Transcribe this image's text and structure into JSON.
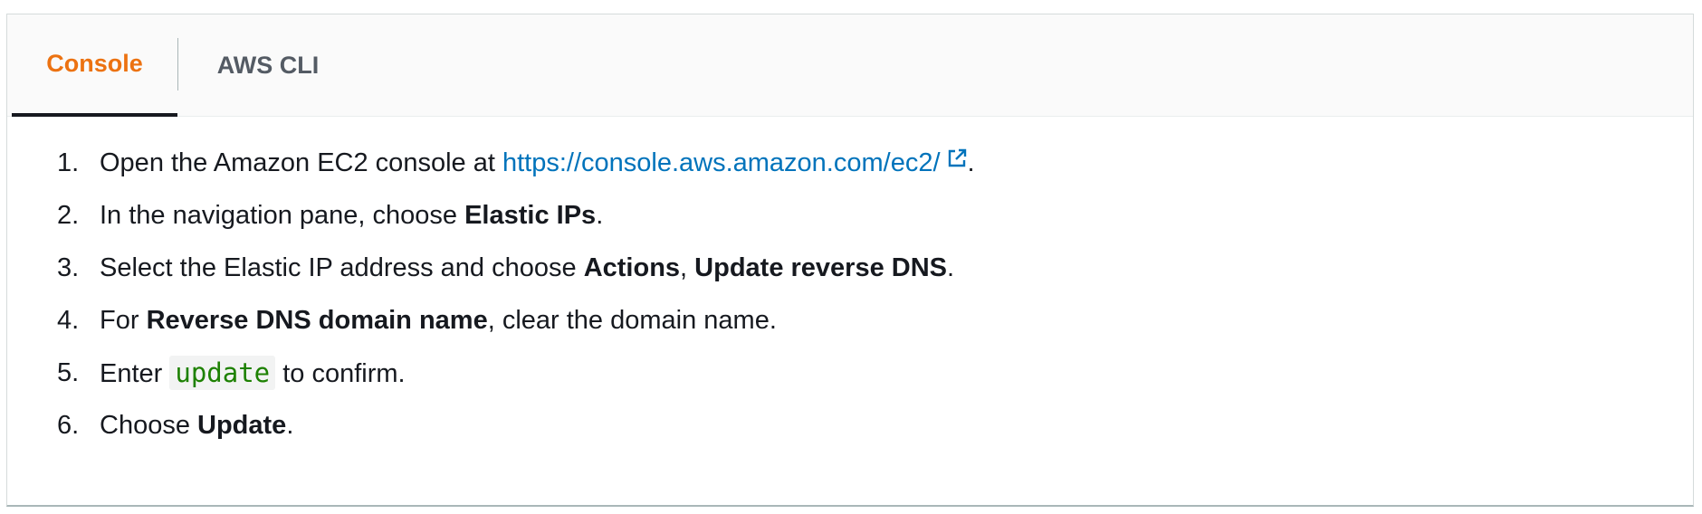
{
  "tabs": {
    "console": "Console",
    "cli": "AWS CLI"
  },
  "steps": [
    {
      "num": "1.",
      "before": "Open the Amazon EC2 console at ",
      "link": "https://console.aws.amazon.com/ec2/",
      "after": "."
    },
    {
      "num": "2.",
      "before": "In the navigation pane, choose ",
      "bold": "Elastic IPs",
      "after": "."
    },
    {
      "num": "3.",
      "before": "Select the Elastic IP address and choose ",
      "bold1": "Actions",
      "mid": ", ",
      "bold2": "Update reverse DNS",
      "after": "."
    },
    {
      "num": "4.",
      "before": "For ",
      "bold": "Reverse DNS domain name",
      "after": ", clear the domain name."
    },
    {
      "num": "5.",
      "before": "Enter ",
      "code": "update",
      "after": " to confirm."
    },
    {
      "num": "6.",
      "before": "Choose ",
      "bold": "Update",
      "after": "."
    }
  ],
  "colors": {
    "active_tab": "#ec7211",
    "link": "#0073bb",
    "code": "#1d8102"
  }
}
